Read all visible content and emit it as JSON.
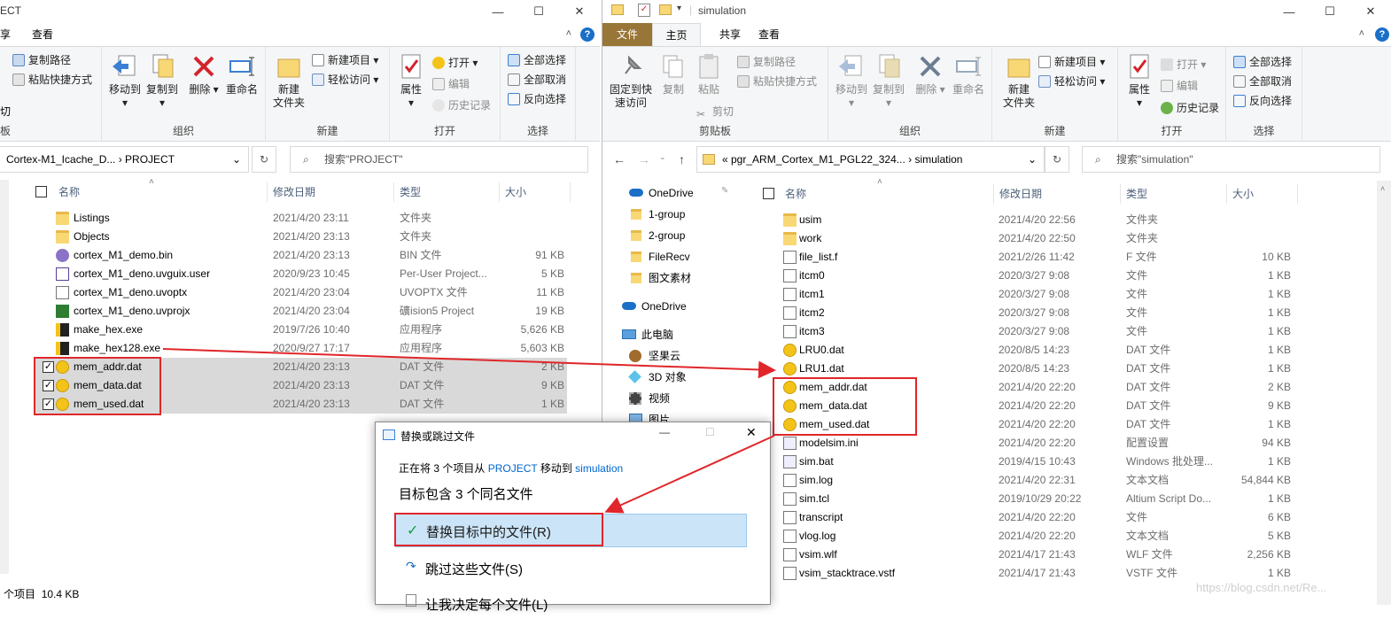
{
  "left": {
    "title": "ECT",
    "tabs": {
      "share": "享",
      "view": "查看"
    },
    "ribbon": {
      "copy_path": "复制路径",
      "paste_shortcut": "粘贴快捷方式",
      "move_to": "移动到",
      "copy_to": "复制到",
      "delete": "删除",
      "rename": "重命名",
      "new_folder": "新建\n文件夹",
      "new_item": "新建项目",
      "easy_access": "轻松访问",
      "properties": "属性",
      "open": "打开",
      "edit": "编辑",
      "history": "历史记录",
      "select_all": "全部选择",
      "select_none": "全部取消",
      "invert": "反向选择",
      "g_org": "组织",
      "g_new": "新建",
      "g_open": "打开",
      "g_select": "选择",
      "cut_frag": "切",
      "board_frag": "板"
    },
    "address": "Cortex-M1_Icache_D...  ›  PROJECT",
    "search_placeholder": "搜索\"PROJECT\"",
    "headers": {
      "name": "名称",
      "date": "修改日期",
      "type": "类型",
      "size": "大小"
    },
    "files": [
      {
        "name": "Listings",
        "date": "2021/4/20 23:11",
        "type": "文件夹",
        "size": "",
        "icon": "folder",
        "sel": false
      },
      {
        "name": "Objects",
        "date": "2021/4/20 23:13",
        "type": "文件夹",
        "size": "",
        "icon": "folder",
        "sel": false
      },
      {
        "name": "cortex_M1_demo.bin",
        "date": "2021/4/20 23:13",
        "type": "BIN 文件",
        "size": "91 KB",
        "icon": "bin",
        "sel": false
      },
      {
        "name": "cortex_M1_deno.uvguix.user",
        "date": "2020/9/23 10:45",
        "type": "Per-User Project...",
        "size": "5 KB",
        "icon": "uv",
        "sel": false
      },
      {
        "name": "cortex_M1_deno.uvoptx",
        "date": "2021/4/20 23:04",
        "type": "UVOPTX 文件",
        "size": "11 KB",
        "icon": "doc",
        "sel": false
      },
      {
        "name": "cortex_M1_deno.uvprojx",
        "date": "2021/4/20 23:04",
        "type": "礦ision5 Project",
        "size": "19 KB",
        "icon": "uvp",
        "sel": false
      },
      {
        "name": "make_hex.exe",
        "date": "2019/7/26 10:40",
        "type": "应用程序",
        "size": "5,626 KB",
        "icon": "exe",
        "sel": false
      },
      {
        "name": "make_hex128.exe",
        "date": "2020/9/27 17:17",
        "type": "应用程序",
        "size": "5,603 KB",
        "icon": "exe",
        "sel": false
      },
      {
        "name": "mem_addr.dat",
        "date": "2021/4/20 23:13",
        "type": "DAT 文件",
        "size": "2 KB",
        "icon": "dat",
        "sel": true
      },
      {
        "name": "mem_data.dat",
        "date": "2021/4/20 23:13",
        "type": "DAT 文件",
        "size": "9 KB",
        "icon": "dat",
        "sel": true
      },
      {
        "name": "mem_used.dat",
        "date": "2021/4/20 23:13",
        "type": "DAT 文件",
        "size": "1 KB",
        "icon": "dat",
        "sel": true
      }
    ],
    "status_count": "个项目",
    "status_size": "10.4 KB"
  },
  "right": {
    "title": "simulation",
    "tabs": {
      "file": "文件",
      "home": "主页",
      "share": "共享",
      "view": "查看"
    },
    "ribbon": {
      "pin": "固定到快\n速访问",
      "copy": "复制",
      "paste": "粘贴",
      "copy_path": "复制路径",
      "paste_shortcut": "粘贴快捷方式",
      "cut": "剪切",
      "move_to": "移动到",
      "copy_to": "复制到",
      "delete": "删除",
      "rename": "重命名",
      "new_folder": "新建\n文件夹",
      "new_item": "新建项目",
      "easy_access": "轻松访问",
      "properties": "属性",
      "open": "打开",
      "edit": "编辑",
      "history": "历史记录",
      "select_all": "全部选择",
      "select_none": "全部取消",
      "invert": "反向选择",
      "g_clip": "剪贴板",
      "g_org": "组织",
      "g_new": "新建",
      "g_open": "打开",
      "g_select": "选择"
    },
    "address": "«  pgr_ARM_Cortex_M1_PGL22_324...  ›  simulation",
    "search_placeholder": "搜索\"simulation\"",
    "headers": {
      "name": "名称",
      "date": "修改日期",
      "type": "类型",
      "size": "大小"
    },
    "nav": [
      {
        "label": "OneDrive",
        "icon": "cloud"
      },
      {
        "label": "1-group",
        "icon": "folder"
      },
      {
        "label": "2-group",
        "icon": "folder"
      },
      {
        "label": "FileRecv",
        "icon": "folder"
      },
      {
        "label": "图文素材",
        "icon": "folder"
      },
      {
        "label": "OneDrive",
        "icon": "cloud"
      },
      {
        "label": "此电脑",
        "icon": "pc"
      },
      {
        "label": "坚果云",
        "icon": "nut"
      },
      {
        "label": "3D 对象",
        "icon": "cube"
      },
      {
        "label": "视频",
        "icon": "video"
      },
      {
        "label": "图片",
        "icon": "pic"
      }
    ],
    "files": [
      {
        "name": "usim",
        "date": "2021/4/20 22:56",
        "type": "文件夹",
        "size": "",
        "icon": "folder"
      },
      {
        "name": "work",
        "date": "2021/4/20 22:50",
        "type": "文件夹",
        "size": "",
        "icon": "folder"
      },
      {
        "name": "file_list.f",
        "date": "2021/2/26 11:42",
        "type": "F 文件",
        "size": "10 KB",
        "icon": "doc"
      },
      {
        "name": "itcm0",
        "date": "2020/3/27 9:08",
        "type": "文件",
        "size": "1 KB",
        "icon": "doc"
      },
      {
        "name": "itcm1",
        "date": "2020/3/27 9:08",
        "type": "文件",
        "size": "1 KB",
        "icon": "doc"
      },
      {
        "name": "itcm2",
        "date": "2020/3/27 9:08",
        "type": "文件",
        "size": "1 KB",
        "icon": "doc"
      },
      {
        "name": "itcm3",
        "date": "2020/3/27 9:08",
        "type": "文件",
        "size": "1 KB",
        "icon": "doc"
      },
      {
        "name": "LRU0.dat",
        "date": "2020/8/5 14:23",
        "type": "DAT 文件",
        "size": "1 KB",
        "icon": "dat"
      },
      {
        "name": "LRU1.dat",
        "date": "2020/8/5 14:23",
        "type": "DAT 文件",
        "size": "1 KB",
        "icon": "dat"
      },
      {
        "name": "mem_addr.dat",
        "date": "2021/4/20 22:20",
        "type": "DAT 文件",
        "size": "2 KB",
        "icon": "dat"
      },
      {
        "name": "mem_data.dat",
        "date": "2021/4/20 22:20",
        "type": "DAT 文件",
        "size": "9 KB",
        "icon": "dat"
      },
      {
        "name": "mem_used.dat",
        "date": "2021/4/20 22:20",
        "type": "DAT 文件",
        "size": "1 KB",
        "icon": "dat"
      },
      {
        "name": "modelsim.ini",
        "date": "2021/4/20 22:20",
        "type": "配置设置",
        "size": "94 KB",
        "icon": "ini"
      },
      {
        "name": "sim.bat",
        "date": "2019/4/15 10:43",
        "type": "Windows 批处理...",
        "size": "1 KB",
        "icon": "ini"
      },
      {
        "name": "sim.log",
        "date": "2021/4/20 22:31",
        "type": "文本文档",
        "size": "54,844 KB",
        "icon": "doc"
      },
      {
        "name": "sim.tcl",
        "date": "2019/10/29 20:22",
        "type": "Altium Script Do...",
        "size": "1 KB",
        "icon": "doc"
      },
      {
        "name": "transcript",
        "date": "2021/4/20 22:20",
        "type": "文件",
        "size": "6 KB",
        "icon": "doc"
      },
      {
        "name": "vlog.log",
        "date": "2021/4/20 22:20",
        "type": "文本文档",
        "size": "5 KB",
        "icon": "doc"
      },
      {
        "name": "vsim.wlf",
        "date": "2021/4/17 21:43",
        "type": "WLF 文件",
        "size": "2,256 KB",
        "icon": "doc"
      },
      {
        "name": "vsim_stacktrace.vstf",
        "date": "2021/4/17 21:43",
        "type": "VSTF 文件",
        "size": "1 KB",
        "icon": "doc"
      }
    ]
  },
  "dialog": {
    "title": "替换或跳过文件",
    "msg_pre": "正在将 3 个项目从 ",
    "src": "PROJECT",
    "msg_mid": " 移动到 ",
    "dst": "simulation",
    "heading": "目标包含 3 个同名文件",
    "opt_replace": "替换目标中的文件(R)",
    "opt_skip": "跳过这些文件(S)",
    "opt_decide": "让我决定每个文件(L)"
  },
  "watermark": "https://blog.csdn.net/Re...",
  "colors": {
    "accent": "#0078d7",
    "highlight": "#e0262a",
    "file_tab": "#987638",
    "selected_row": "#d9d9d9"
  }
}
